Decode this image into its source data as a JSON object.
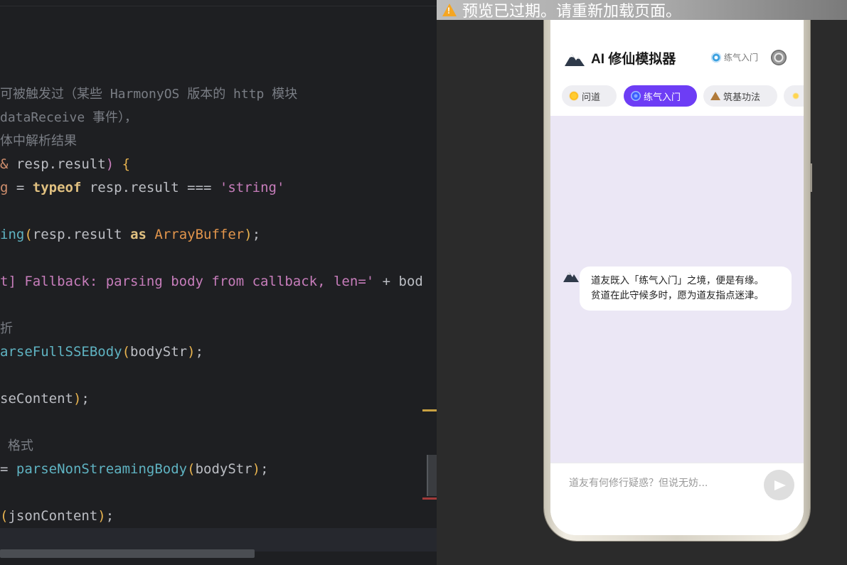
{
  "editor": {
    "lines": [
      {
        "type": "comment",
        "text": "可被触发过（某些 HarmonyOS 版本的 http 模块"
      },
      {
        "type": "comment",
        "text": "dataReceive 事件），"
      },
      {
        "type": "comment",
        "text": "体中解析结果"
      },
      {
        "type": "code",
        "segments": [
          {
            "c": "c-kw",
            "t": "& "
          },
          {
            "c": "c-var",
            "t": "resp.result"
          },
          {
            "c": "c-p1",
            "t": ")"
          },
          {
            "c": "c-var",
            "t": " "
          },
          {
            "c": "c-p2",
            "t": "{"
          }
        ]
      },
      {
        "type": "code",
        "segments": [
          {
            "c": "c-kw",
            "t": "g"
          },
          {
            "c": "c-var",
            "t": " = "
          },
          {
            "c": "c-kwb",
            "t": "typeof"
          },
          {
            "c": "c-var",
            "t": " resp.result "
          },
          {
            "c": "c-var",
            "t": "==="
          },
          {
            "c": "c-var",
            "t": " "
          },
          {
            "c": "c-str",
            "t": "'string'"
          }
        ]
      },
      {
        "type": "code",
        "segments": [
          {
            "c": "c-b",
            "t": "ing"
          },
          {
            "c": "c-p2",
            "t": "("
          },
          {
            "c": "c-var",
            "t": "resp.result "
          },
          {
            "c": "c-kwb",
            "t": "as"
          },
          {
            "c": "c-var",
            "t": " "
          },
          {
            "c": "c-type",
            "t": "ArrayBuffer"
          },
          {
            "c": "c-p2",
            "t": ")"
          },
          {
            "c": "c-var",
            "t": ";"
          }
        ]
      },
      {
        "type": "code",
        "segments": [
          {
            "c": "c-str",
            "t": "t] Fallback: parsing body from callback, len='"
          },
          {
            "c": "c-var",
            "t": " + "
          },
          {
            "c": "c-var",
            "t": "bod"
          }
        ]
      },
      {
        "type": "comment",
        "text": "折"
      },
      {
        "type": "code",
        "segments": [
          {
            "c": "c-b",
            "t": "arseFullSSEBody"
          },
          {
            "c": "c-p2",
            "t": "("
          },
          {
            "c": "c-var",
            "t": "bodyStr"
          },
          {
            "c": "c-p2",
            "t": ")"
          },
          {
            "c": "c-var",
            "t": ";"
          }
        ]
      },
      {
        "type": "code",
        "segments": [
          {
            "c": "c-var",
            "t": "seContent"
          },
          {
            "c": "c-p2",
            "t": ")"
          },
          {
            "c": "c-var",
            "t": ";"
          }
        ]
      },
      {
        "type": "comment",
        "text": " 格式"
      },
      {
        "type": "code",
        "segments": [
          {
            "c": "c-var",
            "t": "= "
          },
          {
            "c": "c-b",
            "t": "parseNonStreamingBody"
          },
          {
            "c": "c-p2",
            "t": "("
          },
          {
            "c": "c-var",
            "t": "bodyStr"
          },
          {
            "c": "c-p2",
            "t": ")"
          },
          {
            "c": "c-var",
            "t": ";"
          }
        ]
      },
      {
        "type": "code",
        "segments": [
          {
            "c": "c-p2",
            "t": "("
          },
          {
            "c": "c-var",
            "t": "jsonContent"
          },
          {
            "c": "c-p2",
            "t": ")"
          },
          {
            "c": "c-var",
            "t": ";"
          }
        ]
      }
    ]
  },
  "banner": {
    "text": "预览已过期。请重新加载页面。"
  },
  "app": {
    "title": "AI 修仙模拟器",
    "realm": "练气入门",
    "tabs": [
      {
        "label": "问道",
        "icon": "sun-icon",
        "active": false
      },
      {
        "label": "练气入门",
        "icon": "spiral-icon",
        "active": true
      },
      {
        "label": "筑基功法",
        "icon": "mountain-icon",
        "active": false
      },
      {
        "label": "",
        "icon": "sparkle-icon",
        "active": false
      }
    ],
    "message": {
      "line1": "道友既入「练气入门」之境，便是有缘。",
      "line2": "贫道在此守候多时，愿为道友指点迷津。"
    },
    "input_placeholder": "道友有何修行疑惑？但说无妨..."
  }
}
